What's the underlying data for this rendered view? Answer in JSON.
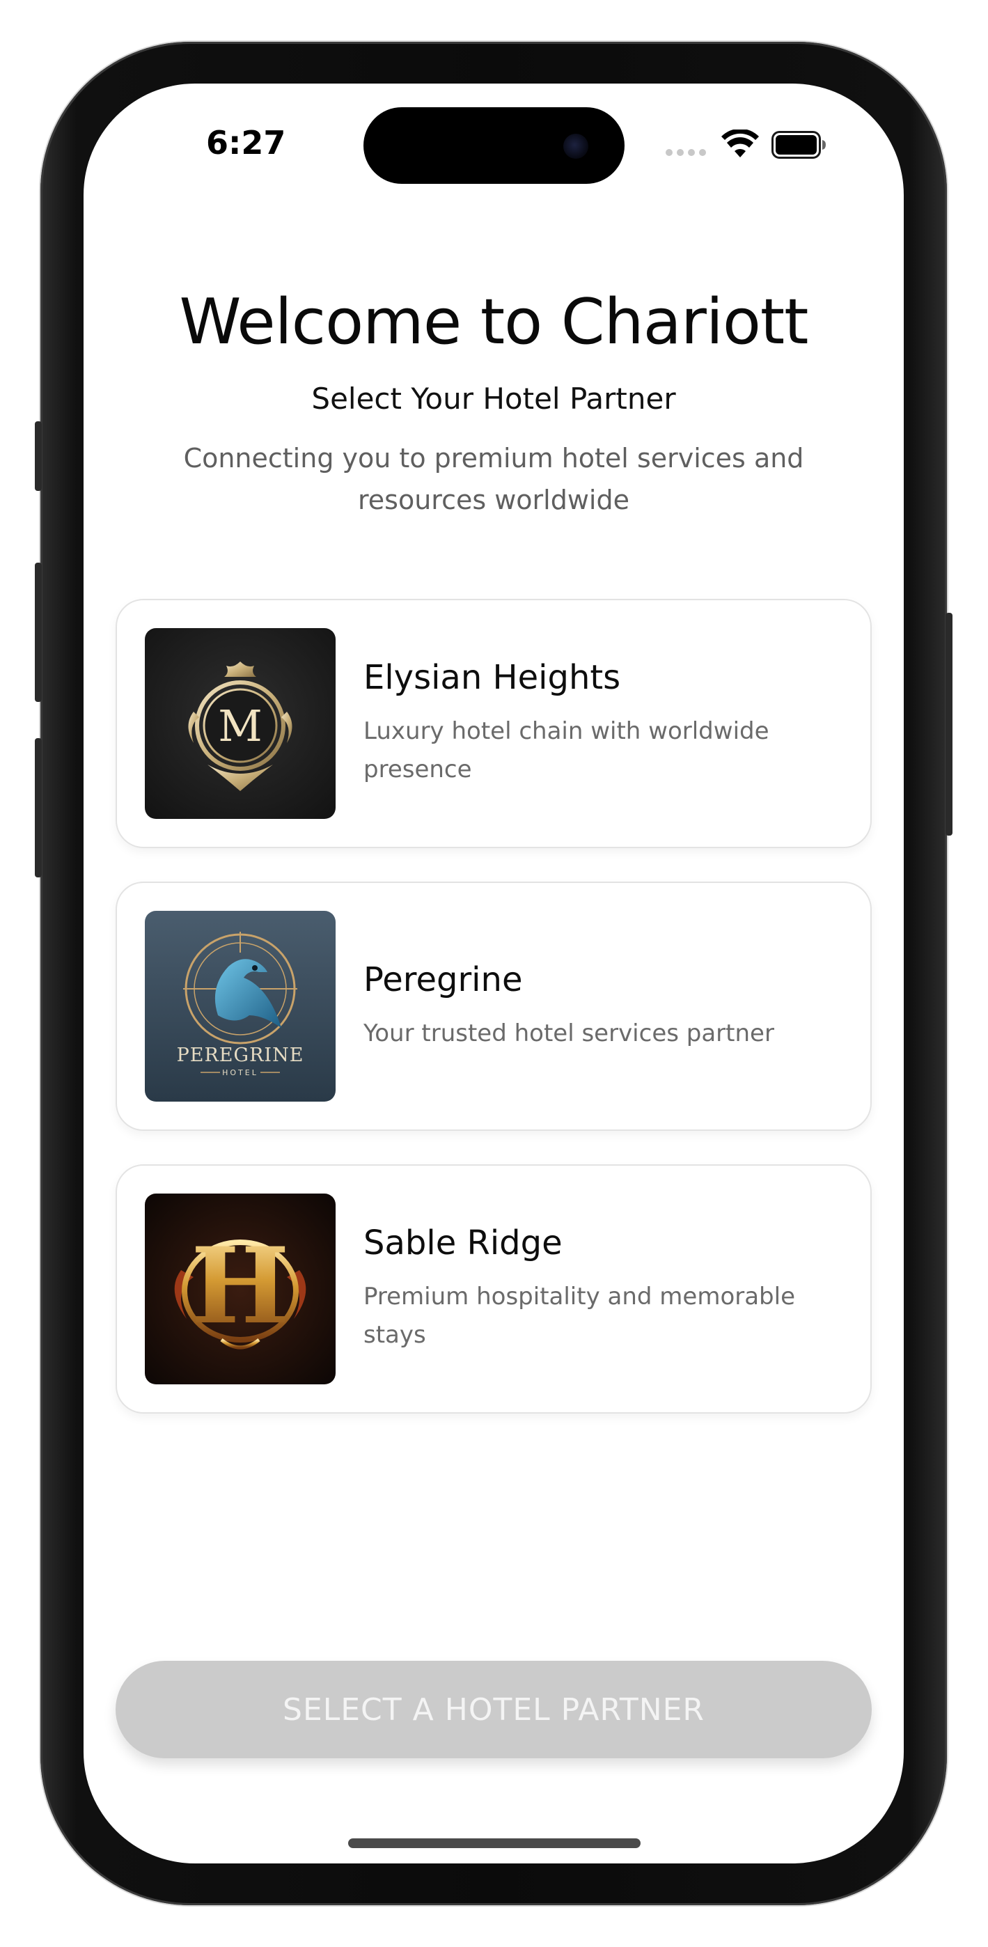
{
  "status_bar": {
    "time": "6:27",
    "icons": [
      "cellular-signal-icon",
      "wifi-icon",
      "battery-icon"
    ]
  },
  "header": {
    "title": "Welcome to Chariott",
    "subtitle": "Select Your Hotel Partner",
    "tagline": "Connecting you to premium hotel services and resources worldwide"
  },
  "partners": [
    {
      "name": "Elysian Heights",
      "description": "Luxury hotel chain with worldwide presence",
      "logo_letter": "M",
      "logo_icon": "crest-monogram-icon"
    },
    {
      "name": "Peregrine",
      "description": "Your trusted hotel services partner",
      "logo_text": "PEREGRINE",
      "logo_subtext": "HOTEL",
      "logo_icon": "falcon-emblem-icon"
    },
    {
      "name": "Sable Ridge",
      "description": "Premium hospitality and memorable stays",
      "logo_letter": "H",
      "logo_icon": "gold-monogram-icon"
    }
  ],
  "cta": {
    "label": "SELECT A HOTEL PARTNER",
    "state": "disabled"
  },
  "colors": {
    "background": "#ffffff",
    "card_border": "#e3e3e3",
    "cta_disabled": "#cbcbcb",
    "text_primary": "#0d0d0d",
    "text_secondary": "#6a6a6a"
  }
}
